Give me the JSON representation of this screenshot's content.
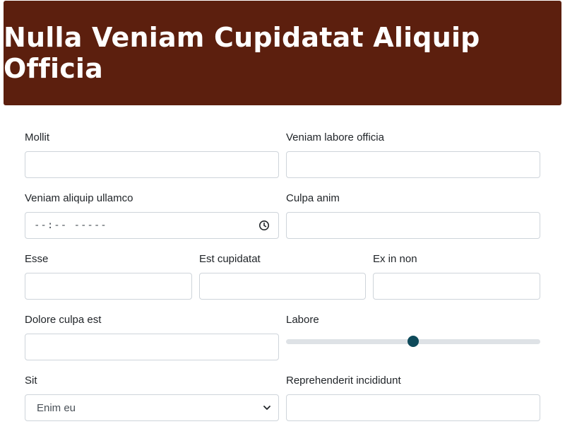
{
  "header": {
    "title": "Nulla Veniam Cupidatat Aliquip Officia",
    "background": "#5c1f0e"
  },
  "form": {
    "mollit": {
      "label": "Mollit",
      "value": ""
    },
    "veniam_labore_officia": {
      "label": "Veniam labore officia",
      "value": ""
    },
    "veniam_aliquip_ullamco": {
      "label": "Veniam aliquip ullamco",
      "value": "--:-- -----"
    },
    "culpa_anim": {
      "label": "Culpa anim",
      "value": ""
    },
    "esse": {
      "label": "Esse",
      "value": ""
    },
    "est_cupidatat": {
      "label": "Est cupidatat",
      "value": ""
    },
    "ex_in_non": {
      "label": "Ex in non",
      "value": ""
    },
    "dolore_culpa_est": {
      "label": "Dolore culpa est",
      "value": ""
    },
    "labore": {
      "label": "Labore",
      "value": 0.5
    },
    "sit": {
      "label": "Sit",
      "selected": "Enim eu"
    },
    "reprehenderit_incididunt": {
      "label": "Reprehenderit incididunt",
      "value": ""
    }
  },
  "icons": {
    "time": "clock-icon",
    "select": "chevron-down-icon"
  },
  "colors": {
    "accent": "#0e4a5a",
    "border": "#ced4da"
  }
}
